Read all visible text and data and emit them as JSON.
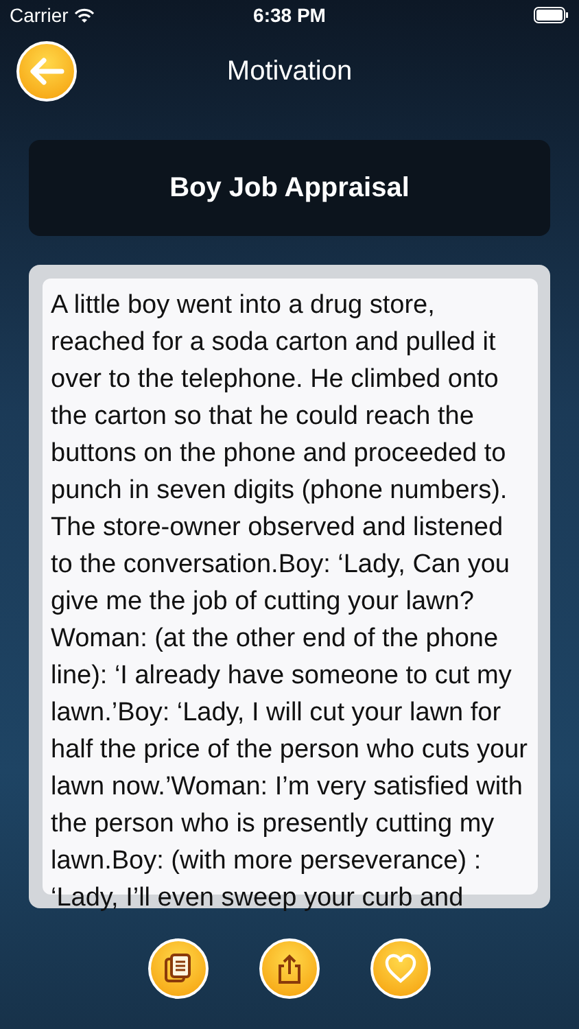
{
  "status_bar": {
    "carrier": "Carrier",
    "time": "6:38 PM"
  },
  "header": {
    "title": "Motivation"
  },
  "story": {
    "title": "Boy Job Appraisal",
    "body": "A little boy went into a drug store, reached for a soda carton and pulled it over to the telephone. He climbed onto the carton so that he could reach the buttons on the phone and proceeded to punch in seven digits (phone numbers).  The store-owner observed and listened to the conversation.Boy: ‘Lady, Can you give me the job of cutting your lawn?Woman: (at the other end of the phone line): ‘I already have someone to cut my lawn.’Boy: ‘Lady, I will cut your lawn for half the price of the person who cuts your lawn now.’Woman: I’m very satisfied with the person who is presently cutting my lawn.Boy: (with more perseverance) : ‘Lady, I’ll even sweep your curb and"
  },
  "actions": [
    {
      "kind": "copy"
    },
    {
      "kind": "share"
    },
    {
      "kind": "favorite"
    }
  ]
}
